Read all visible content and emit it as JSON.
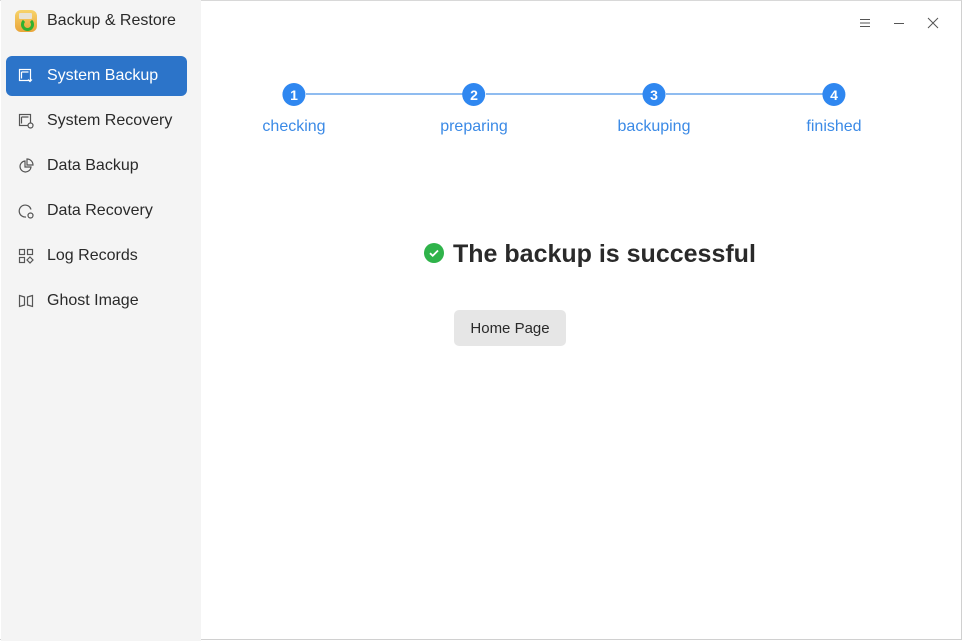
{
  "app": {
    "title": "Backup & Restore",
    "icon": "backup-restore-app-icon"
  },
  "window_controls": [
    {
      "name": "menu",
      "icon": "hamburger-menu-icon"
    },
    {
      "name": "minimize",
      "icon": "minimize-icon"
    },
    {
      "name": "close",
      "icon": "close-icon"
    }
  ],
  "sidebar": {
    "items": [
      {
        "label": "System Backup",
        "icon": "system-backup-icon",
        "active": true
      },
      {
        "label": "System Recovery",
        "icon": "system-recovery-icon",
        "active": false
      },
      {
        "label": "Data Backup",
        "icon": "data-backup-icon",
        "active": false
      },
      {
        "label": "Data Recovery",
        "icon": "data-recovery-icon",
        "active": false
      },
      {
        "label": "Log Records",
        "icon": "log-records-icon",
        "active": false
      },
      {
        "label": "Ghost Image",
        "icon": "ghost-image-icon",
        "active": false
      }
    ]
  },
  "stepper": {
    "steps": [
      {
        "number": "1",
        "label": "checking"
      },
      {
        "number": "2",
        "label": "preparing"
      },
      {
        "number": "3",
        "label": "backuping"
      },
      {
        "number": "4",
        "label": "finished"
      }
    ],
    "current_step": 4
  },
  "result": {
    "icon": "success-check-icon",
    "message": "The backup is successful",
    "button_label": "Home Page"
  },
  "colors": {
    "accent": "#2c74c9",
    "step": "#2f87f0",
    "step_line": "#8fbcf0",
    "success": "#2fb34a"
  }
}
